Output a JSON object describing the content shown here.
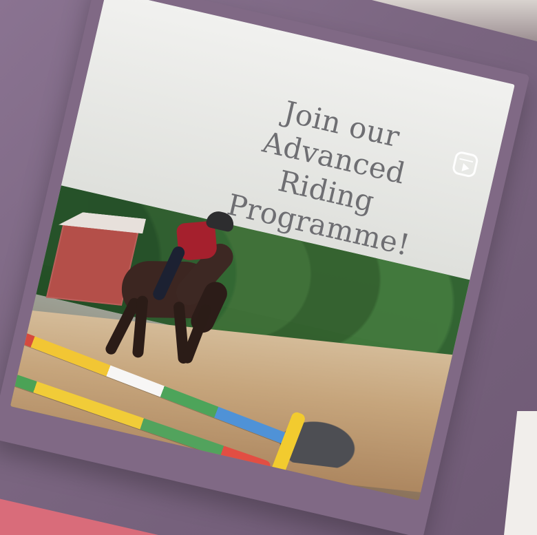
{
  "promo": {
    "headline_line1": "Join our",
    "headline_line2": "Advanced Riding",
    "headline_line3": "Programme!"
  },
  "icons": {
    "reel": "reels-icon"
  },
  "colors": {
    "frame": "#806985",
    "background": "#7d6680",
    "headline": "#6e6e72"
  }
}
